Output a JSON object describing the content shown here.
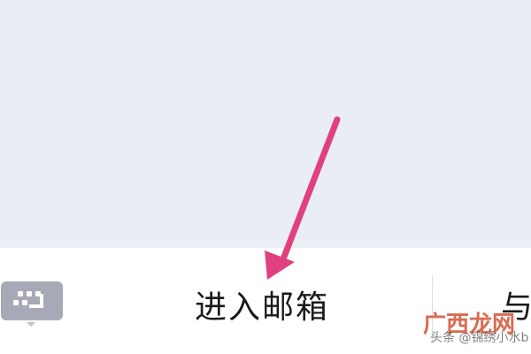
{
  "chat": {
    "background_color": "#ebedf5"
  },
  "menu_bar": {
    "keyboard_icon": "keyboard-icon",
    "items": [
      {
        "label": "进入邮箱"
      },
      {
        "label": "与"
      }
    ]
  },
  "annotation": {
    "arrow_color": "#e0407e",
    "arrow_icon": "arrow-pointer-icon"
  },
  "watermark": {
    "logo_text": "广西龙网",
    "source_text": "头条 @锦绣小水b"
  }
}
